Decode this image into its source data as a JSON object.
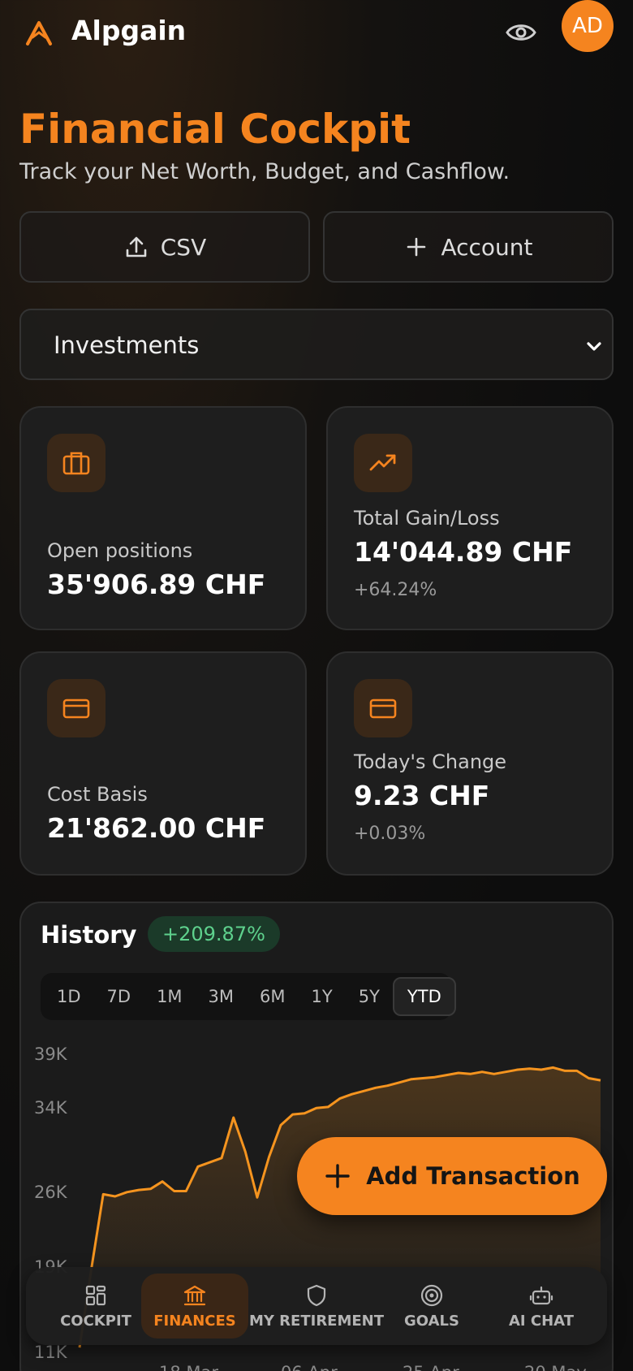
{
  "header": {
    "brand": "Alpgain",
    "avatar_initials": "AD",
    "logo_icon": "mountain-logo-icon",
    "visibility_icon": "eye-icon"
  },
  "page": {
    "title": "Financial Cockpit",
    "subtitle": "Track your Net Worth, Budget, and Cashflow."
  },
  "actions": {
    "csv_label": "CSV",
    "account_label": "Account"
  },
  "filter": {
    "selected": "Investments"
  },
  "cards": [
    {
      "icon": "briefcase-icon",
      "label": "Open positions",
      "value": "35'906.89 CHF",
      "sub": ""
    },
    {
      "icon": "trending-up-icon",
      "label": "Total Gain/Loss",
      "value": "14'044.89 CHF",
      "sub": "+64.24%"
    },
    {
      "icon": "credit-card-icon",
      "label": "Cost Basis",
      "value": "21'862.00 CHF",
      "sub": ""
    },
    {
      "icon": "credit-card-icon",
      "label": "Today's Change",
      "value": "9.23 CHF",
      "sub": "+0.03%"
    }
  ],
  "history": {
    "title": "History",
    "change": "+209.87%",
    "ranges": [
      "1D",
      "7D",
      "1M",
      "3M",
      "6M",
      "1Y",
      "5Y",
      "YTD"
    ],
    "active_range": "YTD"
  },
  "chart_data": {
    "type": "area",
    "y_ticks": [
      "39K",
      "34K",
      "26K",
      "19K",
      "11K"
    ],
    "y_tick_values": [
      39000,
      34000,
      26000,
      19000,
      11000
    ],
    "ylim": [
      11000,
      39000
    ],
    "x_ticks": [
      "18 Mar",
      "06 Apr",
      "25 Apr",
      "20 May"
    ],
    "series": [
      {
        "values": [
          11600,
          19000,
          26000,
          25800,
          26200,
          26400,
          26500,
          27200,
          26300,
          26300,
          28600,
          29000,
          29400,
          33200,
          30000,
          25700,
          29500,
          32500,
          33500,
          33600,
          34100,
          34200,
          35000,
          35400,
          35700,
          36000,
          36200,
          36500,
          36800,
          36900,
          37000,
          37200,
          37400,
          37300,
          37500,
          37300,
          37500,
          37700,
          37800,
          37700,
          37900,
          37600,
          37600,
          36900,
          36700
        ]
      }
    ],
    "grid": false,
    "color": "#f5941f"
  },
  "fab": {
    "label": "Add Transaction"
  },
  "nav": {
    "items": [
      {
        "label": "COCKPIT",
        "icon": "dashboard-icon"
      },
      {
        "label": "FINANCES",
        "icon": "bank-icon"
      },
      {
        "label": "MY RETIREMENT",
        "icon": "shield-icon"
      },
      {
        "label": "GOALS",
        "icon": "target-icon"
      },
      {
        "label": "AI CHAT",
        "icon": "robot-icon"
      }
    ],
    "active": "FINANCES"
  },
  "colors": {
    "accent": "#f5841f",
    "positive": "#5ed18d",
    "card_bg": "#1e1e1e"
  }
}
